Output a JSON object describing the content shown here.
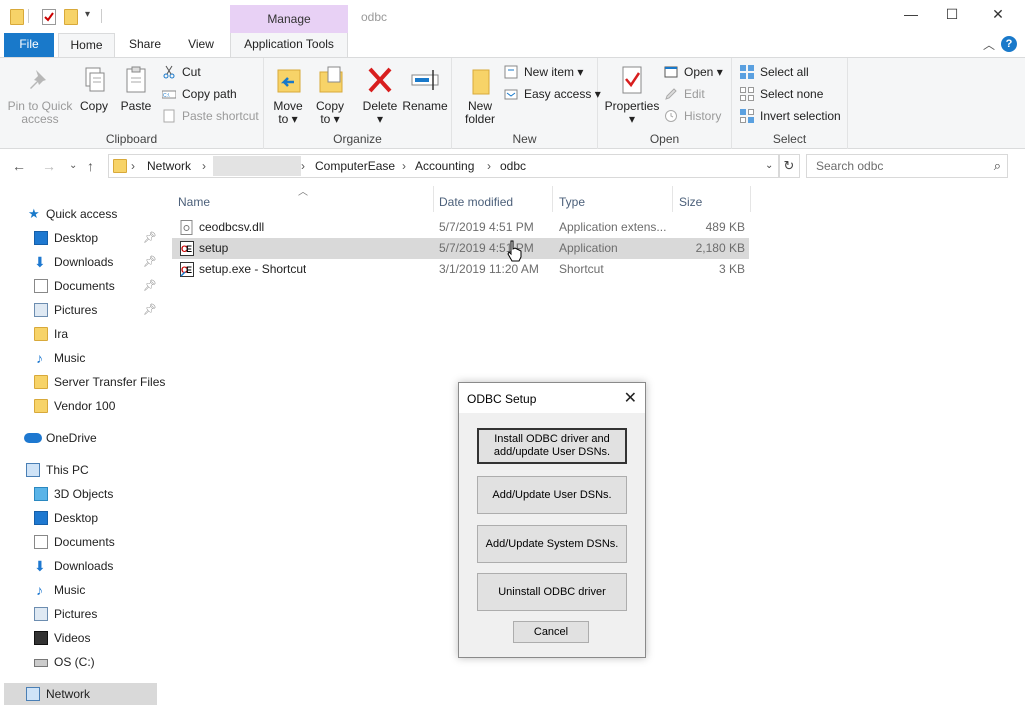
{
  "window": {
    "title": "odbc",
    "context_tab": "Manage",
    "minimize": "—",
    "maximize": "☐",
    "close": "✕"
  },
  "ribbon_tabs": {
    "file": "File",
    "home": "Home",
    "share": "Share",
    "view": "View",
    "app_tools": "Application Tools"
  },
  "clipboard": {
    "pin": "Pin to Quick access",
    "pin_l1": "Pin to Quick",
    "pin_l2": "access",
    "copy": "Copy",
    "paste": "Paste",
    "cut": "Cut",
    "copy_path": "Copy path",
    "paste_shortcut": "Paste shortcut",
    "label": "Clipboard"
  },
  "organize": {
    "move_l1": "Move",
    "move_l2": "to",
    "copy_l1": "Copy",
    "copy_l2": "to",
    "delete": "Delete",
    "rename": "Rename",
    "label": "Organize"
  },
  "new_group": {
    "folder_l1": "New",
    "folder_l2": "folder",
    "new_item": "New item",
    "easy_access": "Easy access",
    "label": "New"
  },
  "open_group": {
    "properties": "Properties",
    "open": "Open",
    "edit": "Edit",
    "history": "History",
    "label": "Open"
  },
  "select_group": {
    "select_all": "Select all",
    "select_none": "Select none",
    "invert": "Invert selection",
    "label": "Select"
  },
  "address": {
    "crumbs": [
      "Network",
      "ComputerEase",
      "Accounting",
      "odbc"
    ],
    "search_placeholder": "Search odbc"
  },
  "nav": {
    "quick_access": "Quick access",
    "qa_items": [
      "Desktop",
      "Downloads",
      "Documents",
      "Pictures",
      "Ira",
      "Music",
      "Server Transfer Files",
      "Vendor 100"
    ],
    "onedrive": "OneDrive",
    "this_pc": "This PC",
    "pc_items": [
      "3D Objects",
      "Desktop",
      "Documents",
      "Downloads",
      "Music",
      "Pictures",
      "Videos",
      "OS (C:)"
    ],
    "network": "Network"
  },
  "columns": {
    "name": "Name",
    "date": "Date modified",
    "type": "Type",
    "size": "Size"
  },
  "files": [
    {
      "name": "ceodbcsv.dll",
      "date": "5/7/2019 4:51 PM",
      "type": "Application extens...",
      "size": "489 KB"
    },
    {
      "name": "setup",
      "date": "5/7/2019 4:51 PM",
      "type": "Application",
      "size": "2,180 KB"
    },
    {
      "name": "setup.exe - Shortcut",
      "date": "3/1/2019 11:20 AM",
      "type": "Shortcut",
      "size": "3 KB"
    }
  ],
  "dialog": {
    "title": "ODBC Setup",
    "close": "✕",
    "btn_install_l1": "Install ODBC driver and",
    "btn_install_l2": "add/update User DSNs.",
    "btn_user": "Add/Update User DSNs.",
    "btn_system": "Add/Update System DSNs.",
    "btn_uninstall": "Uninstall ODBC driver",
    "btn_cancel": "Cancel"
  },
  "colors": {
    "accent": "#1979ca",
    "manage_tab": "#e8d1f5",
    "hover_row": "#d9d9d9"
  }
}
